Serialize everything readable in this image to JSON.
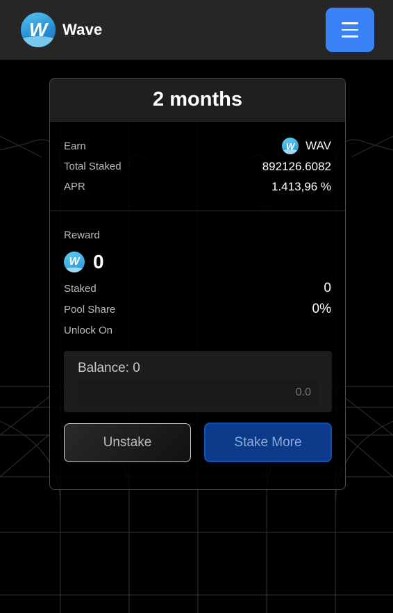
{
  "header": {
    "brand": "Wave",
    "logo_letter": "W",
    "menu_icon": "hamburger-menu-icon",
    "accent": "#3b82f6"
  },
  "pool": {
    "title": "2 months",
    "earn_label": "Earn",
    "earn_token": "WAV",
    "total_staked_label": "Total Staked",
    "total_staked_value": "892126.6082",
    "apr_label": "APR",
    "apr_value": "1.413,96 %"
  },
  "user": {
    "reward_label": "Reward",
    "reward_value": "0",
    "staked_label": "Staked",
    "staked_value": "0",
    "pool_share_label": "Pool Share",
    "pool_share_value": "0%",
    "unlock_on_label": "Unlock On",
    "unlock_on_value": ""
  },
  "balance": {
    "label": "Balance: 0",
    "input_placeholder": "0.0"
  },
  "actions": {
    "unstake_label": "Unstake",
    "stake_more_label": "Stake More"
  }
}
